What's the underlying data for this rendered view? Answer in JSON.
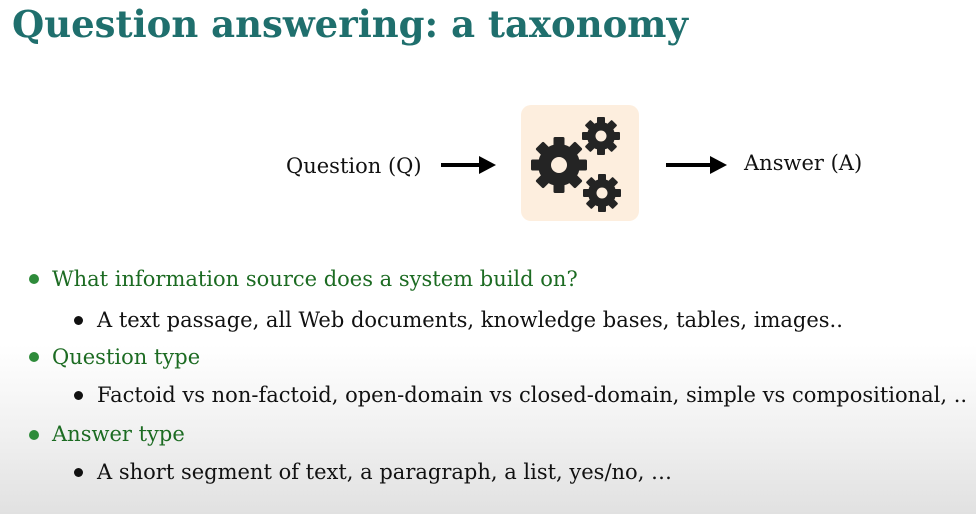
{
  "title": "Question answering: a taxonomy",
  "diagram": {
    "input_label": "Question (Q)",
    "output_label": "Answer (A)",
    "process_icon": "gears-icon",
    "box_color": "#fdeede"
  },
  "bullets": [
    {
      "text": "What information source does a system build on?",
      "sub": [
        "A text passage, all Web documents, knowledge bases, tables, images.."
      ]
    },
    {
      "text": "Question type",
      "sub": [
        "Factoid vs non-factoid, open-domain vs closed-domain, simple vs compositional, .."
      ]
    },
    {
      "text": "Answer type",
      "sub": [
        "A short segment of text, a paragraph, a list, yes/no, …"
      ]
    }
  ],
  "colors": {
    "title": "#1f6f6d",
    "bullet_level1": "#1c6b22",
    "bullet_dot": "#2e8b3a"
  }
}
